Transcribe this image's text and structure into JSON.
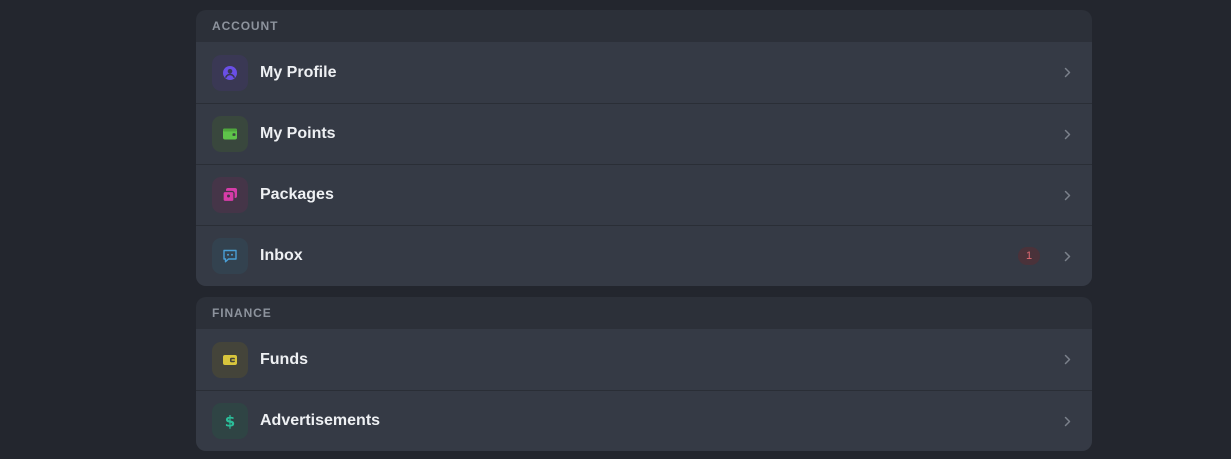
{
  "account": {
    "header": "ACCOUNT",
    "items": [
      {
        "label": "My Profile",
        "icon": "user-icon",
        "color": "#6a4fe6",
        "bg": "#3a3854"
      },
      {
        "label": "My Points",
        "icon": "wallet-icon",
        "color": "#5ec44a",
        "bg": "#39473d"
      },
      {
        "label": "Packages",
        "icon": "packages-icon",
        "color": "#d63ca8",
        "bg": "#453548"
      },
      {
        "label": "Inbox",
        "icon": "message-icon",
        "color": "#4a9fd6",
        "bg": "#33424f",
        "badge": "1"
      }
    ]
  },
  "finance": {
    "header": "FINANCE",
    "items": [
      {
        "label": "Funds",
        "icon": "funds-icon",
        "color": "#d8c53c",
        "bg": "#44443a"
      },
      {
        "label": "Advertisements",
        "icon": "dollar-icon",
        "color": "#2bbf9a",
        "bg": "#2f4444"
      }
    ]
  }
}
